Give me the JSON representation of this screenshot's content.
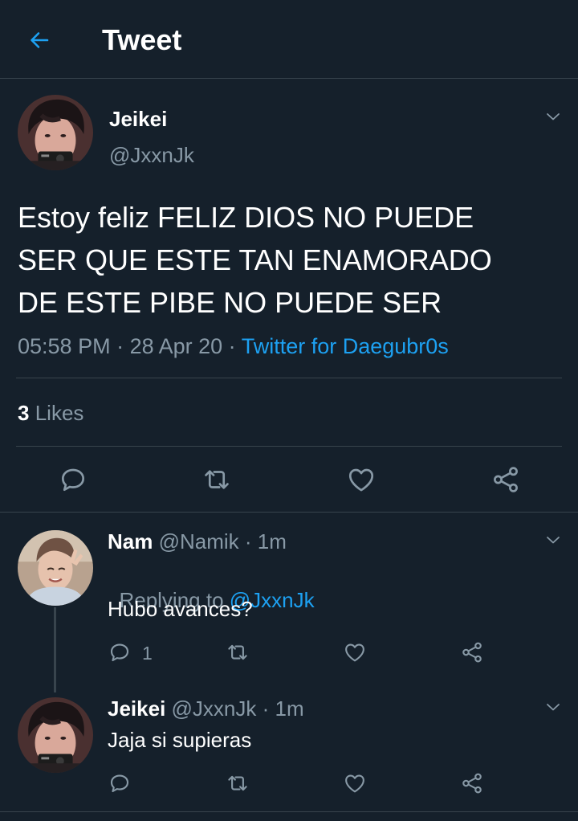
{
  "header": {
    "title": "Tweet"
  },
  "tweet": {
    "name": "Jeikei",
    "handle": "@JxxnJk",
    "text_lines": [
      "Estoy feliz FELIZ DIOS NO PUEDE",
      "SER QUE ESTE TAN ENAMORADO",
      "DE ESTE PIBE NO PUEDE SER"
    ],
    "time": "05:58 PM",
    "sep1": " · ",
    "date": "28 Apr 20",
    "sep2": " · ",
    "source": "Twitter for Daegubr0s",
    "likes_count": "3",
    "likes_label": "Likes"
  },
  "replies": [
    {
      "name": "Nam",
      "handle": "@Namik",
      "sep": " · ",
      "time": "1m",
      "replying_prefix": "Replying to ",
      "replying_handle": "@JxxnJk",
      "text": "Hubo avances?",
      "reply_count": "1"
    },
    {
      "name": "Jeikei",
      "handle": "@JxxnJk",
      "sep": " · ",
      "time": "1m",
      "text": "Jaja si supieras"
    }
  ],
  "colors": {
    "background": "#15202b",
    "accent": "#1da1f2",
    "muted": "#8899a6",
    "divider": "#38444d"
  },
  "icons": {
    "back": "arrow-left-icon",
    "reply": "speech-bubble-icon",
    "retweet": "retweet-icon",
    "like": "heart-icon",
    "share": "share-icon",
    "menu": "chevron-down-icon"
  }
}
